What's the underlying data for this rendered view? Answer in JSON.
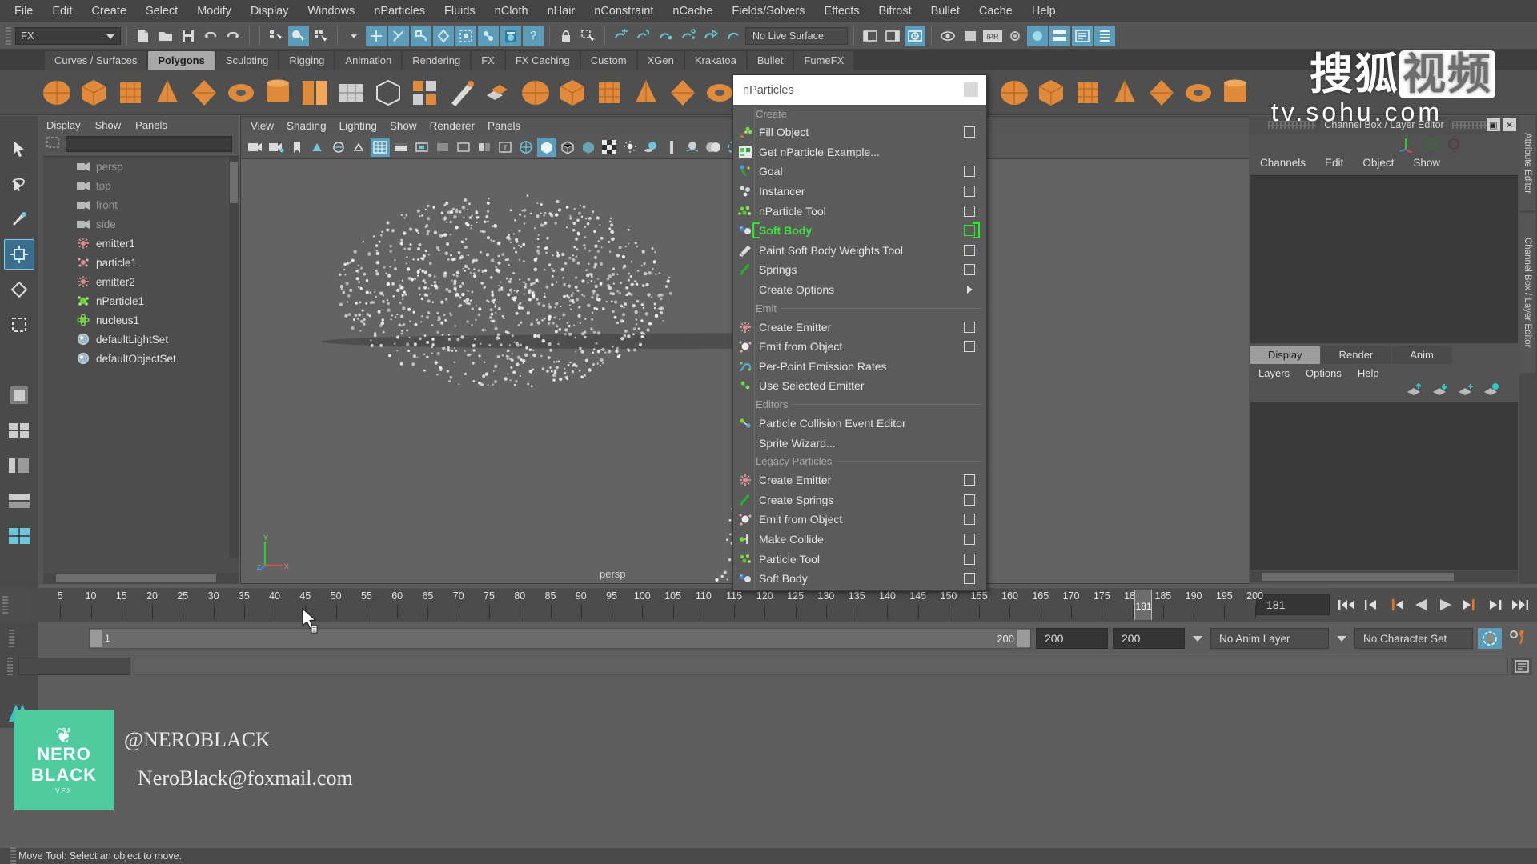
{
  "app": {
    "title": "Autodesk Maya"
  },
  "menubar": {
    "items": [
      "File",
      "Edit",
      "Create",
      "Select",
      "Modify",
      "Display",
      "Windows",
      "nParticles",
      "Fluids",
      "nCloth",
      "nHair",
      "nConstraint",
      "nCache",
      "Fields/Solvers",
      "Effects",
      "Bifrost",
      "Bullet",
      "Cache",
      "Help"
    ]
  },
  "statusline": {
    "menuset": "FX",
    "live_surface": "No Live Surface",
    "icons": [
      "new-scene-icon",
      "open-scene-icon",
      "save-scene-icon",
      "undo-icon",
      "redo-icon",
      "select-hierarchy-icon",
      "select-object-icon",
      "select-component-icon",
      "snap-grid-icon",
      "snap-curve-icon",
      "snap-point-icon",
      "snap-view-icon",
      "snap-projected-icon",
      "make-live-icon",
      "lock-icon",
      "selection-mask-icon",
      "render-current-frame-icon",
      "render-region-icon",
      "ipr-render-icon",
      "render-settings-icon",
      "hypergraph-icon",
      "outliner-icon",
      "node-editor-icon",
      "attribute-editor-toggle-icon",
      "channel-box-toggle-icon",
      "layer-editor-toggle-icon"
    ]
  },
  "shelf": {
    "tabs": [
      "Curves / Surfaces",
      "Polygons",
      "Sculpting",
      "Rigging",
      "Animation",
      "Rendering",
      "FX",
      "FX Caching",
      "Custom",
      "XGen",
      "Krakatoa",
      "Bullet",
      "FumeFX"
    ],
    "active_tab": "Polygons",
    "icons": [
      "poly-sphere-icon",
      "poly-cube-icon",
      "poly-cylinder-icon",
      "poly-cone-icon",
      "poly-torus-icon",
      "poly-plane-icon",
      "poly-pyramid-icon",
      "poly-prism-icon",
      "poly-pipe-icon",
      "poly-helix-icon",
      "poly-gear-icon",
      "poly-soccerball-icon",
      "poly-platonic-icon",
      "combine-icon",
      "separate-icon",
      "mirror-icon",
      "smooth-icon",
      "extrude-icon",
      "bevel-icon",
      "bridge-icon",
      "append-icon",
      "sculpt-icon",
      "booleans-icon",
      "duplicate-face-icon",
      "connect-icon",
      "detach-icon",
      "merge-icon",
      "multi-cut-icon",
      "target-weld-icon",
      "quad-draw-icon",
      "crease-icon",
      "transfer-attributes-icon",
      "uv-editor-icon"
    ]
  },
  "outliner": {
    "menus": [
      "Display",
      "Show",
      "Panels"
    ],
    "search_placeholder": "",
    "items": [
      {
        "label": "persp",
        "icon": "camera-icon",
        "dim": true
      },
      {
        "label": "top",
        "icon": "camera-icon",
        "dim": true
      },
      {
        "label": "front",
        "icon": "camera-icon",
        "dim": true
      },
      {
        "label": "side",
        "icon": "camera-icon",
        "dim": true
      },
      {
        "label": "emitter1",
        "icon": "emitter-icon",
        "dim": false
      },
      {
        "label": "particle1",
        "icon": "particle-icon",
        "dim": false
      },
      {
        "label": "emitter2",
        "icon": "emitter-icon",
        "dim": false
      },
      {
        "label": "nParticle1",
        "icon": "nparticle-icon",
        "dim": false
      },
      {
        "label": "nucleus1",
        "icon": "nucleus-icon",
        "dim": false
      },
      {
        "label": "defaultLightSet",
        "icon": "set-icon",
        "dim": false
      },
      {
        "label": "defaultObjectSet",
        "icon": "set-icon",
        "dim": false
      }
    ]
  },
  "viewport": {
    "menus": [
      "View",
      "Shading",
      "Lighting",
      "Show",
      "Renderer",
      "Panels"
    ],
    "camera_label": "persp",
    "axis_labels": {
      "y": "Y",
      "x": "X",
      "z": "Z"
    },
    "toolbar_icons": [
      "select-camera-icon",
      "bookmark-icon",
      "camera-attrs-icon",
      "grid-toggle-icon",
      "image-plane-icon",
      "gate-mask-icon",
      "resolution-gate-icon",
      "film-gate-icon",
      "two-d-pan-zoom-icon",
      "grid-display-icon",
      "film-back-icon",
      "viewport-layout-icon",
      "xray-icon",
      "xray-joints-icon",
      "wireframe-icon",
      "smooth-shade-icon",
      "flat-shade-icon",
      "textured-icon",
      "lights-icon",
      "shadows-icon",
      "ao-icon",
      "motion-blur-icon",
      "multisample-icon",
      "depth-peel-icon",
      "isolate-select-icon"
    ]
  },
  "npmenu": {
    "title": "nParticles",
    "sections": [
      {
        "label": "Create",
        "items": [
          {
            "label": "Fill Object",
            "icon": "fill-object-icon",
            "option": true,
            "highlight": false
          },
          {
            "label": "Get nParticle Example...",
            "icon": "get-example-icon",
            "option": false,
            "highlight": false
          },
          {
            "label": "Goal",
            "icon": "goal-icon",
            "option": true,
            "highlight": false
          },
          {
            "label": "Instancer",
            "icon": "instancer-icon",
            "option": true,
            "highlight": false
          },
          {
            "label": "nParticle Tool",
            "icon": "nparticle-tool-icon",
            "option": true,
            "highlight": false
          },
          {
            "label": "Soft Body",
            "icon": "soft-body-icon",
            "option": true,
            "highlight": true
          },
          {
            "label": "Paint Soft Body Weights Tool",
            "icon": "paint-weights-icon",
            "option": true,
            "highlight": false
          },
          {
            "label": "Springs",
            "icon": "springs-icon",
            "option": true,
            "highlight": false
          },
          {
            "label": "Create Options",
            "icon": "",
            "submenu": true,
            "highlight": false
          }
        ]
      },
      {
        "label": "Emit",
        "items": [
          {
            "label": "Create Emitter",
            "icon": "create-emitter-icon",
            "option": true,
            "highlight": false
          },
          {
            "label": "Emit from Object",
            "icon": "emit-object-icon",
            "option": true,
            "highlight": false
          },
          {
            "label": "Per-Point Emission Rates",
            "icon": "per-point-icon",
            "option": false,
            "highlight": false
          },
          {
            "label": "Use Selected Emitter",
            "icon": "use-emitter-icon",
            "option": false,
            "highlight": false
          }
        ]
      },
      {
        "label": "Editors",
        "items": [
          {
            "label": "Particle Collision Event Editor",
            "icon": "collision-event-icon",
            "option": false,
            "highlight": false
          },
          {
            "label": "Sprite Wizard...",
            "icon": "",
            "option": false,
            "highlight": false
          }
        ]
      },
      {
        "label": "Legacy Particles",
        "items": [
          {
            "label": "Create Emitter",
            "icon": "create-emitter-icon",
            "option": true,
            "highlight": false
          },
          {
            "label": "Create Springs",
            "icon": "springs-icon",
            "option": true,
            "highlight": false
          },
          {
            "label": "Emit from Object",
            "icon": "emit-object-icon",
            "option": true,
            "highlight": false
          },
          {
            "label": "Make Collide",
            "icon": "make-collide-icon",
            "option": true,
            "highlight": false
          },
          {
            "label": "Particle Tool",
            "icon": "particle-tool-icon",
            "option": true,
            "highlight": false
          },
          {
            "label": "Soft Body",
            "icon": "soft-body-icon",
            "option": true,
            "highlight": false
          }
        ]
      }
    ]
  },
  "channelbox": {
    "title": "Channel Box / Layer Editor",
    "menus": [
      "Channels",
      "Edit",
      "Object",
      "Show"
    ],
    "tabs": [
      "Display",
      "Render",
      "Anim"
    ],
    "active_tab": "Display",
    "layer_menus": [
      "Layers",
      "Options",
      "Help"
    ],
    "layer_buttons": [
      "move-layer-up-icon",
      "move-layer-down-icon",
      "create-new-layer-icon",
      "create-layer-from-selected-icon"
    ]
  },
  "righttabs": {
    "items": [
      "Attribute Editor",
      "Channel Box / Layer Editor"
    ]
  },
  "timeline": {
    "tick_labels": [
      "5",
      "10",
      "15",
      "20",
      "25",
      "30",
      "35",
      "40",
      "45",
      "50",
      "55",
      "60",
      "65",
      "70",
      "75",
      "80",
      "85",
      "90",
      "95",
      "100",
      "105",
      "110",
      "115",
      "120",
      "125",
      "130",
      "135",
      "140",
      "145",
      "150",
      "155",
      "160",
      "165",
      "170",
      "175",
      "180",
      "185",
      "190",
      "195",
      "200"
    ],
    "current_frame": "181",
    "current_frame_field": "181",
    "playback_icons": [
      "go-to-start-icon",
      "step-back-keyframe-icon",
      "step-back-frame-icon",
      "play-backwards-icon",
      "play-forwards-icon",
      "step-forward-frame-icon",
      "step-forward-keyframe-icon",
      "go-to-end-icon"
    ]
  },
  "rangeslider": {
    "start": "1",
    "end": "200",
    "playback_end": "200",
    "anim_end": "200",
    "anim_layer": "No Anim Layer",
    "character_set": "No Character Set",
    "auto_key_icon": "auto-keyframe-icon",
    "prefs_icon": "animation-preferences-icon"
  },
  "helpline": {
    "text": "Move Tool: Select an object to move."
  },
  "watermarks": {
    "nero_line1": "NERO",
    "nero_line2": "BLACK",
    "nero_sub": "VFX",
    "handle": "@NEROBLACK",
    "mail": "NeroBlack@foxmail.com",
    "sohu_a": "搜狐",
    "sohu_b": "视频",
    "sohu_url": "tv.sohu.com"
  },
  "colors": {
    "accent_blue": "#5d9cb8",
    "highlight_green": "#39e339",
    "shelf_orange": "#e08a3c",
    "panel_bg": "#5a5a5a",
    "watermark_green": "#4fcba0"
  }
}
